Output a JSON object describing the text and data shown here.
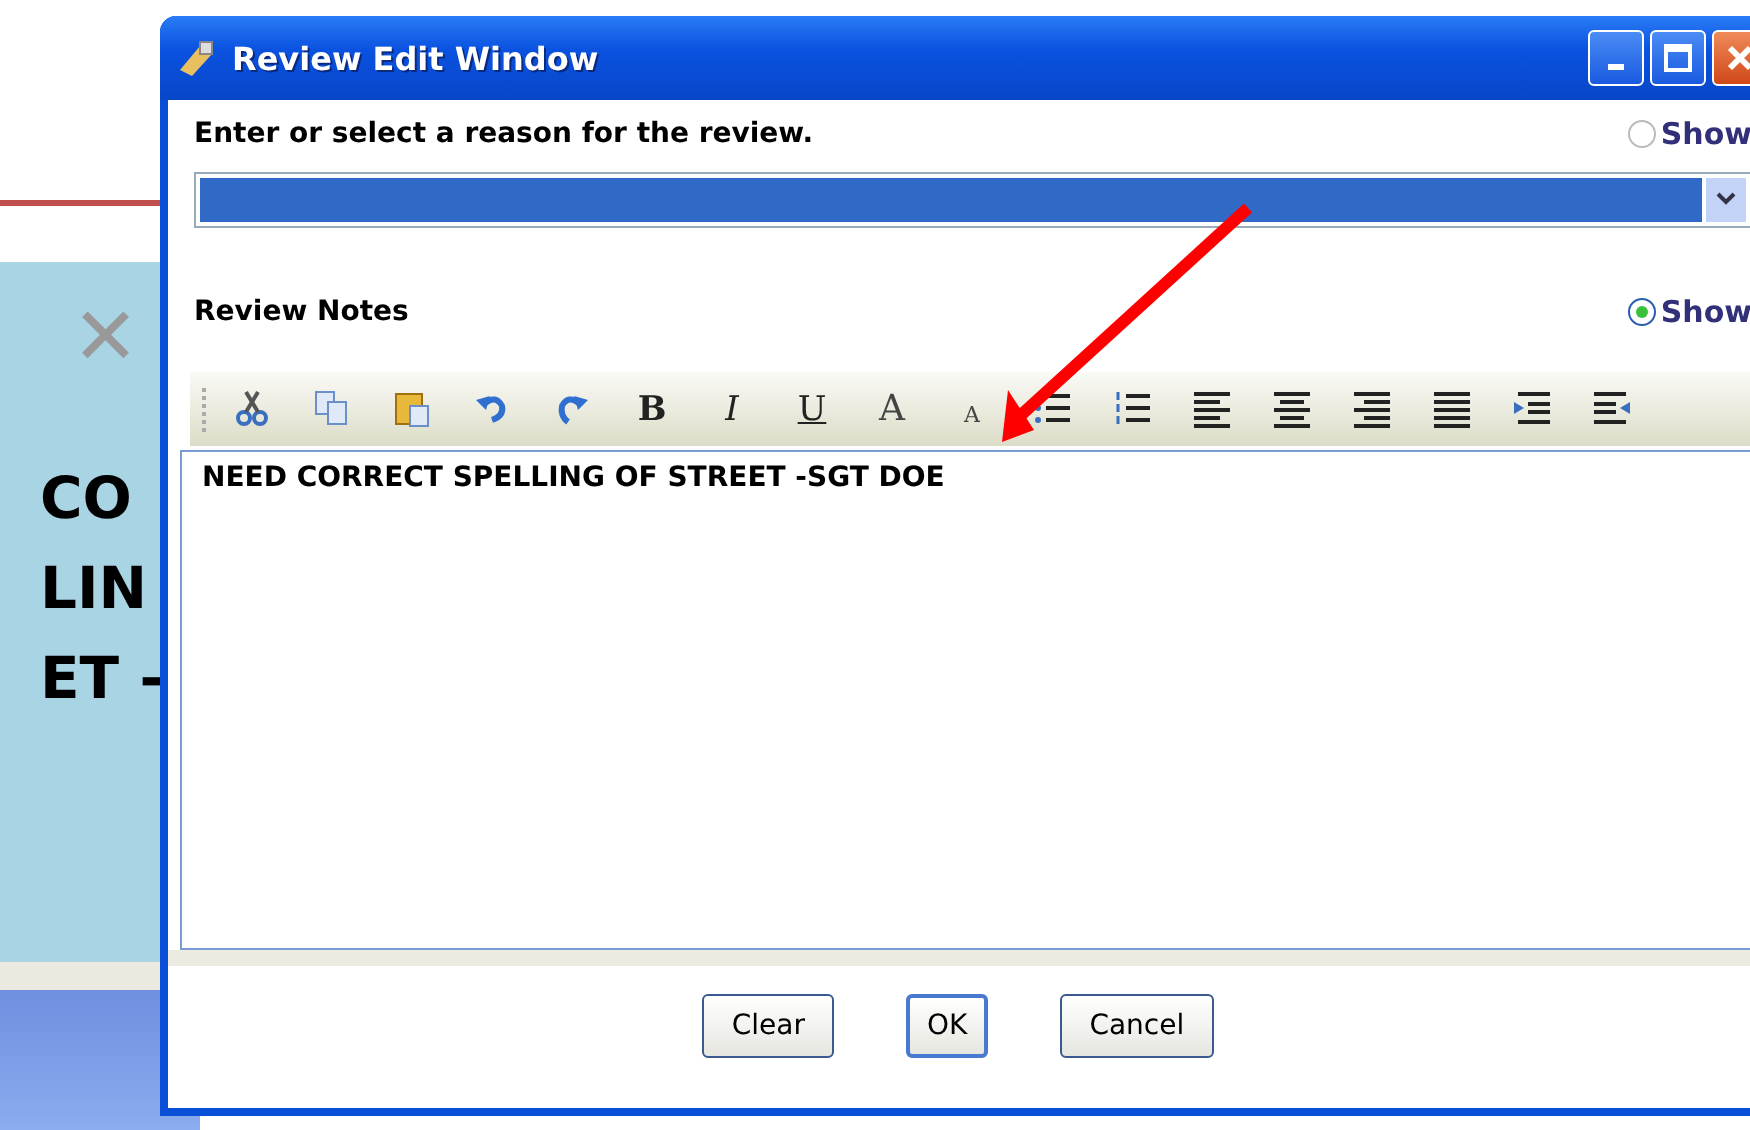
{
  "background": {
    "close": "✕",
    "lines": [
      "CO",
      "LIN",
      "ET -"
    ]
  },
  "window": {
    "title": "Review Edit Window"
  },
  "reason": {
    "label": "Enter or select a reason for the review.",
    "show": {
      "label": "Show",
      "selected": false
    },
    "dropdown": {
      "highlighted": true
    }
  },
  "notes": {
    "label": "Review Notes",
    "show": {
      "label": "Show",
      "selected": true
    },
    "text": "NEED CORRECT SPELLING OF STREET -SGT DOE"
  },
  "toolbar": [
    {
      "kind": "cut"
    },
    {
      "kind": "copy"
    },
    {
      "kind": "paste"
    },
    {
      "kind": "undo"
    },
    {
      "kind": "redo"
    },
    {
      "kind": "bold",
      "label": "B"
    },
    {
      "kind": "italic",
      "label": "I"
    },
    {
      "kind": "underline",
      "label": "U"
    },
    {
      "kind": "grow",
      "label": "A"
    },
    {
      "kind": "shrink",
      "label": "A"
    },
    {
      "kind": "bullets"
    },
    {
      "kind": "numbers"
    },
    {
      "kind": "align-left"
    },
    {
      "kind": "align-center"
    },
    {
      "kind": "align-right"
    },
    {
      "kind": "justify"
    },
    {
      "kind": "indent"
    },
    {
      "kind": "outdent"
    }
  ],
  "buttons": [
    {
      "label": "Clear",
      "default": false
    },
    {
      "label": "OK",
      "default": true
    },
    {
      "label": "Cancel",
      "default": false
    }
  ]
}
